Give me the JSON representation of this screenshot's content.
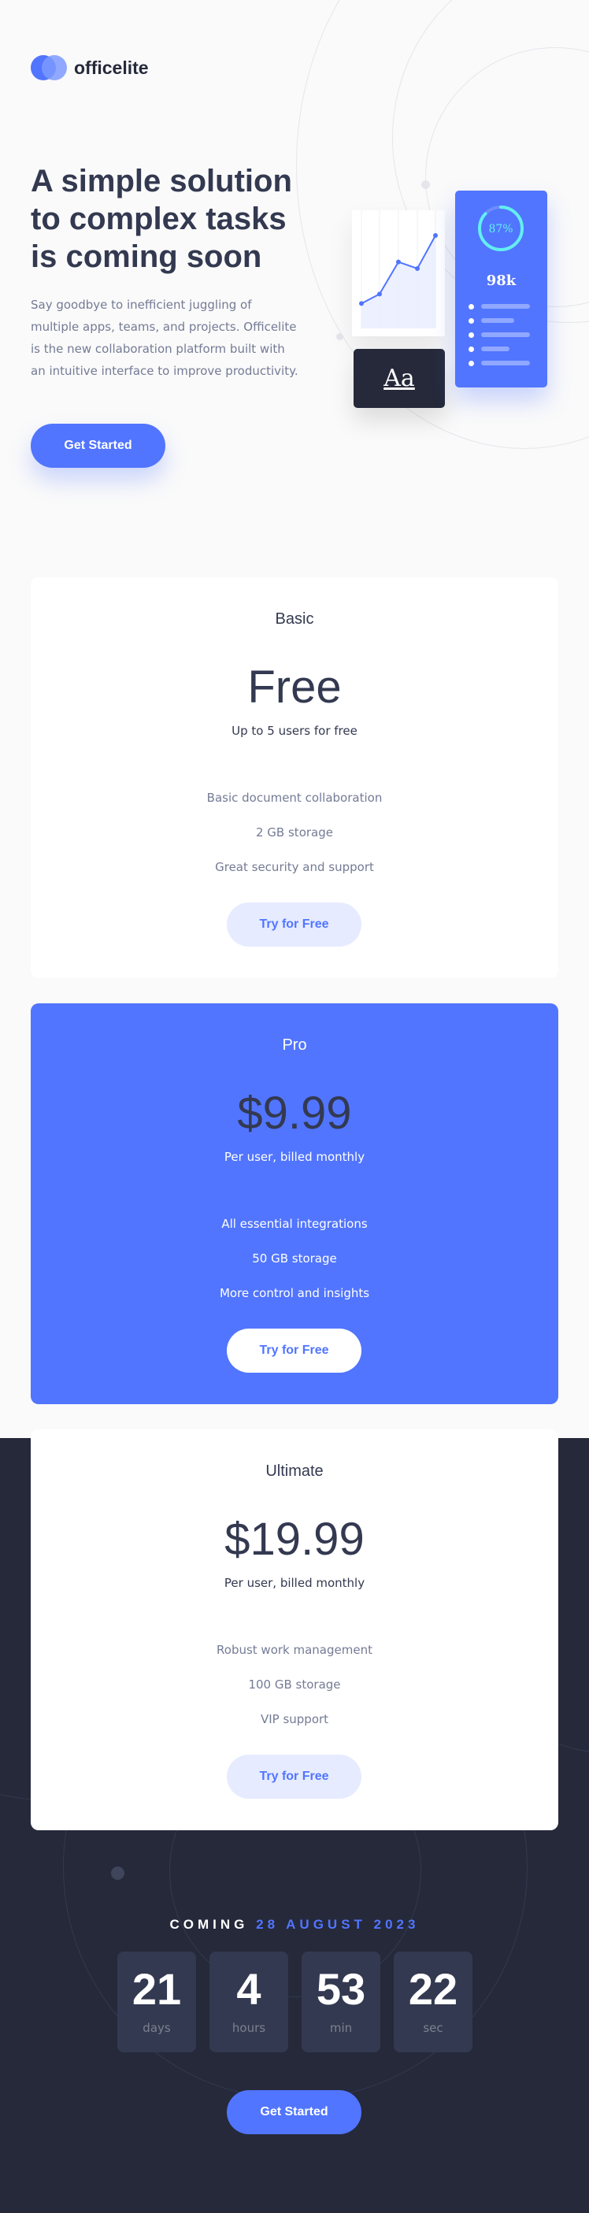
{
  "brand": {
    "name": "officelite"
  },
  "hero": {
    "title": "A simple solution to complex tasks is coming soon",
    "text": "Say goodbye to inefficient juggling of multiple apps, teams, and projects. Officelite is the new collaboration platform built with an intuitive interface to improve productivity.",
    "cta_label": "Get Started"
  },
  "illustration": {
    "progress_label": "87%",
    "progress_value": 0.87,
    "stat_value": "98k",
    "font_sample": "Aa",
    "chart_points": [
      0.18,
      0.28,
      0.62,
      0.55,
      0.9
    ]
  },
  "plans": [
    {
      "name": "Basic",
      "price": "Free",
      "subtitle": "Up to 5 users for free",
      "features": [
        "Basic document collaboration",
        "2 GB storage",
        "Great security and support"
      ],
      "cta_label": "Try for Free"
    },
    {
      "name": "Pro",
      "price": "$9.99",
      "subtitle": "Per user, billed monthly",
      "features": [
        "All essential integrations",
        "50 GB storage",
        "More control and insights"
      ],
      "cta_label": "Try for Free"
    },
    {
      "name": "Ultimate",
      "price": "$19.99",
      "subtitle": "Per user, billed monthly",
      "features": [
        "Robust work management",
        "100 GB storage",
        "VIP support"
      ],
      "cta_label": "Try for Free"
    }
  ],
  "countdown": {
    "prefix": "COMING",
    "date": "28 AUGUST 2023",
    "units": [
      {
        "value": "21",
        "label": "days"
      },
      {
        "value": "4",
        "label": "hours"
      },
      {
        "value": "53",
        "label": "min"
      },
      {
        "value": "22",
        "label": "sec"
      }
    ],
    "cta_label": "Get Started"
  },
  "colors": {
    "accent": "#5175FF",
    "dark": "#25293A",
    "text": "#333950",
    "muted": "#747B95",
    "soft": "#E6EBFF"
  }
}
